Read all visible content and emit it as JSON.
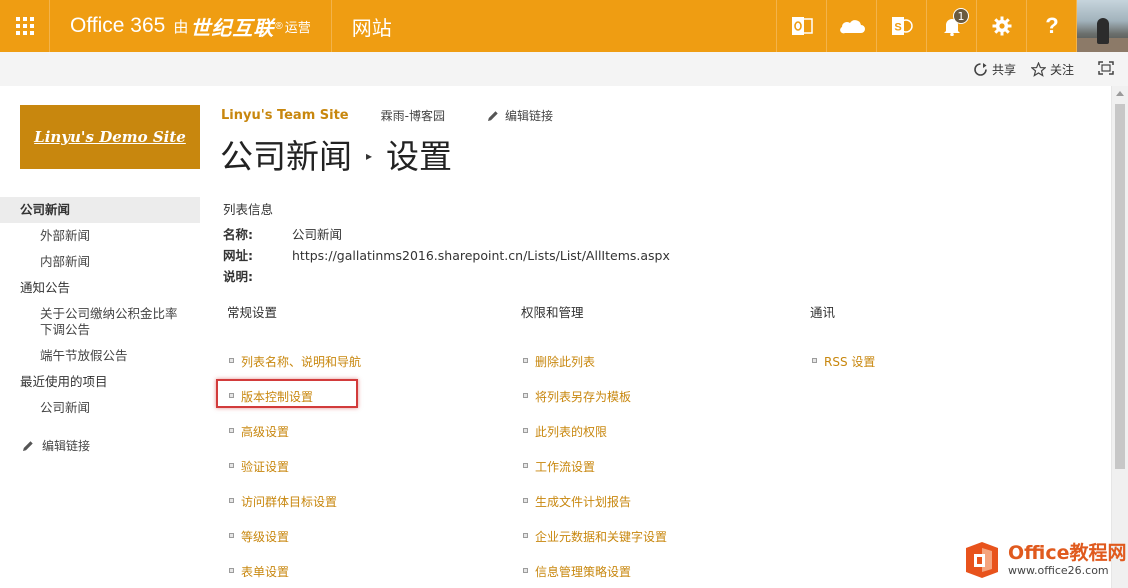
{
  "colors": {
    "suite_bar": "#ef9d12",
    "accent_link": "#c8870e",
    "highlight_box": "#d23b3b"
  },
  "suite": {
    "brand": "Office 365",
    "by": "由",
    "operator": "世纪互联",
    "operated": "运营",
    "app_name": "网站",
    "notifications_count": "1",
    "icons": [
      "waffle-icon",
      "outlook-icon",
      "onedrive-icon",
      "sharepoint-icon",
      "bell-icon",
      "gear-icon",
      "help-icon"
    ]
  },
  "actions": {
    "share": "共享",
    "follow": "关注"
  },
  "site_logo_text": "Linyu's Demo Site",
  "topnav": {
    "team_site": "Linyu's Team Site",
    "blog": "霖雨-博客园",
    "edit_links": "编辑链接"
  },
  "title": {
    "list": "公司新闻",
    "page": "设置"
  },
  "leftnav": {
    "items": [
      {
        "label": "公司新闻",
        "level": 0,
        "selected": true
      },
      {
        "label": "外部新闻",
        "level": 1
      },
      {
        "label": "内部新闻",
        "level": 1
      },
      {
        "label": "通知公告",
        "level": 0
      },
      {
        "label": "关于公司缴纳公积金比率下调公告",
        "level": 1
      },
      {
        "label": "端午节放假公告",
        "level": 1
      },
      {
        "label": "最近使用的项目",
        "level": 0
      },
      {
        "label": "公司新闻",
        "level": 1
      }
    ],
    "edit_links": "编辑链接"
  },
  "list_info": {
    "header": "列表信息",
    "name_label": "名称:",
    "name_value": "公司新闻",
    "url_label": "网址:",
    "url_value": "https://gallatinms2016.sharepoint.cn/Lists/List/AllItems.aspx",
    "desc_label": "说明:"
  },
  "columns": {
    "general": {
      "title": "常规设置",
      "links": [
        "列表名称、说明和导航",
        "版本控制设置",
        "高级设置",
        "验证设置",
        "访问群体目标设置",
        "等级设置",
        "表单设置"
      ]
    },
    "permissions": {
      "title": "权限和管理",
      "links": [
        "删除此列表",
        "将列表另存为模板",
        "此列表的权限",
        "工作流设置",
        "生成文件计划报告",
        "企业元数据和关键字设置",
        "信息管理策略设置"
      ]
    },
    "communications": {
      "title": "通讯",
      "links": [
        "RSS 设置"
      ]
    }
  },
  "watermark": {
    "title": "Office教程网",
    "url": "www.office26.com"
  }
}
